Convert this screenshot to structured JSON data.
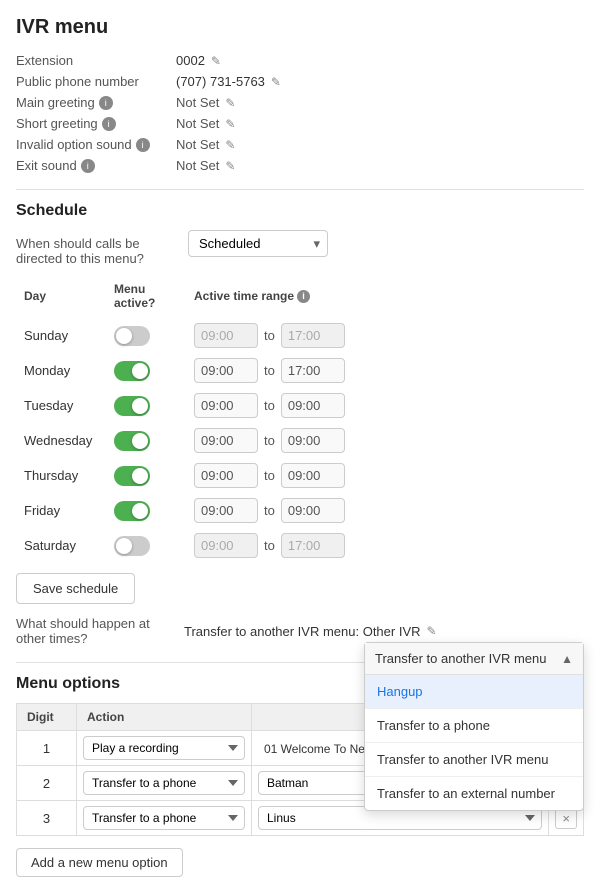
{
  "page": {
    "title": "IVR menu"
  },
  "fields": {
    "extension_label": "Extension",
    "extension_value": "0002",
    "phone_label": "Public phone number",
    "phone_value": "(707) 731-5763",
    "main_greeting_label": "Main greeting",
    "main_greeting_value": "Not Set",
    "short_greeting_label": "Short greeting",
    "short_greeting_value": "Not Set",
    "invalid_option_label": "Invalid option sound",
    "invalid_option_value": "Not Set",
    "exit_sound_label": "Exit sound",
    "exit_sound_value": "Not Set"
  },
  "schedule": {
    "title": "Schedule",
    "when_label": "When should calls be directed to this menu?",
    "select_value": "Scheduled",
    "columns": {
      "day": "Day",
      "menu_active": "Menu active?",
      "time_range": "Active time range"
    },
    "days": [
      {
        "name": "Sunday",
        "active": false,
        "from": "09:00",
        "to": "17:00"
      },
      {
        "name": "Monday",
        "active": true,
        "from": "09:00",
        "to": "17:00"
      },
      {
        "name": "Tuesday",
        "active": true,
        "from": "09:00",
        "to": "09:00"
      },
      {
        "name": "Wednesday",
        "active": true,
        "from": "09:00",
        "to": "09:00"
      },
      {
        "name": "Thursday",
        "active": true,
        "from": "09:00",
        "to": "09:00"
      },
      {
        "name": "Friday",
        "active": true,
        "from": "09:00",
        "to": "09:00"
      },
      {
        "name": "Saturday",
        "active": false,
        "from": "09:00",
        "to": "17:00"
      }
    ],
    "save_btn": "Save schedule",
    "other_times_label": "What should happen at other times?",
    "other_times_value": "Transfer to another IVR menu: Other IVR"
  },
  "menu_options": {
    "title": "Menu options",
    "col_digit": "Digit",
    "col_action": "Action",
    "rows": [
      {
        "digit": "1",
        "action": "Play a recording",
        "target": "01 Welcome To New"
      },
      {
        "digit": "2",
        "action": "Transfer to a phone",
        "target": "Batman"
      },
      {
        "digit": "3",
        "action": "Transfer to a phone",
        "target": "Linus"
      }
    ],
    "add_btn": "Add a new menu option"
  },
  "dropdown": {
    "header": "Transfer to another IVR menu",
    "items": [
      {
        "label": "Hangup",
        "highlighted": true
      },
      {
        "label": "Transfer to a phone",
        "highlighted": false
      },
      {
        "label": "Transfer to another IVR menu",
        "highlighted": false
      },
      {
        "label": "Transfer to an external number",
        "highlighted": false
      }
    ]
  }
}
